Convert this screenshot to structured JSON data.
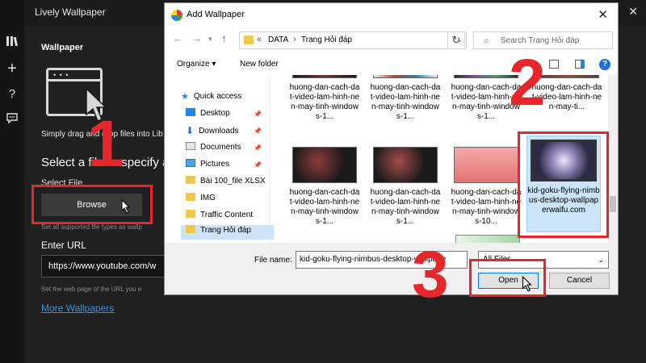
{
  "lively": {
    "app_title": "Lively Wallpaper",
    "section_title": "Wallpaper",
    "drop_text": "Simply drag and drop files into Lib",
    "select_text": "Select a file or specify a v",
    "select_file_label": "Select File",
    "browse_label": "Browse",
    "support_text": "Set all supported file types as wallp",
    "url_label": "Enter URL",
    "url_value": "https://www.youtube.com/w",
    "url_help": "Set the web page of the URL you e",
    "more_link": "More Wallpapers"
  },
  "annotations": [
    "1",
    "2",
    "3"
  ],
  "dialog": {
    "title": "Add Wallpaper",
    "breadcrumb": [
      "DATA",
      "Trang Hỏi đáp"
    ],
    "search_placeholder": "Search Trang Hỏi đáp",
    "organize": "Organize ▾",
    "new_folder": "New folder",
    "nav": {
      "quick_access": "Quick access",
      "items": [
        "Desktop",
        "Downloads",
        "Documents",
        "Pictures",
        "Bài 100_file XLSX",
        "IMG",
        "Traffic Content",
        "Trang Hỏi đáp"
      ]
    },
    "files": {
      "row1": [
        "huong-dan-cach-dat-video-lam-hinh-nen-may-tinh-windows-1...",
        "huong-dan-cach-dat-video-lam-hinh-nen-may-tinh-windows-1...",
        "huong-dan-cach-dat-video-lam-hinh-nen-may-tinh-windows-1...",
        "huong-dan-cach-dat-video-lam-hinh-nen-may-ti..."
      ],
      "row2": [
        "huong-dan-cach-dat-video-lam-hinh-nen-may-tinh-windows-1...",
        "huong-dan-cach-dat-video-lam-hinh-nen-may-tinh-windows-1...",
        "huong-dan-cach-dat-video-lam-hinh-nen-may-tinh-windows-10..."
      ],
      "selected": "kid-goku-flying-nimbus-desktop-wallpaperwaifu.com"
    },
    "file_name_label": "File name:",
    "file_name_value": "kid-goku-flying-nimbus-desktop-wallpape",
    "file_type": "All Files",
    "open_label": "Open",
    "cancel_label": "Cancel"
  },
  "colors": {
    "annotation": "#e5262a",
    "accent": "#0078d7",
    "selection": "#cce4f7"
  }
}
